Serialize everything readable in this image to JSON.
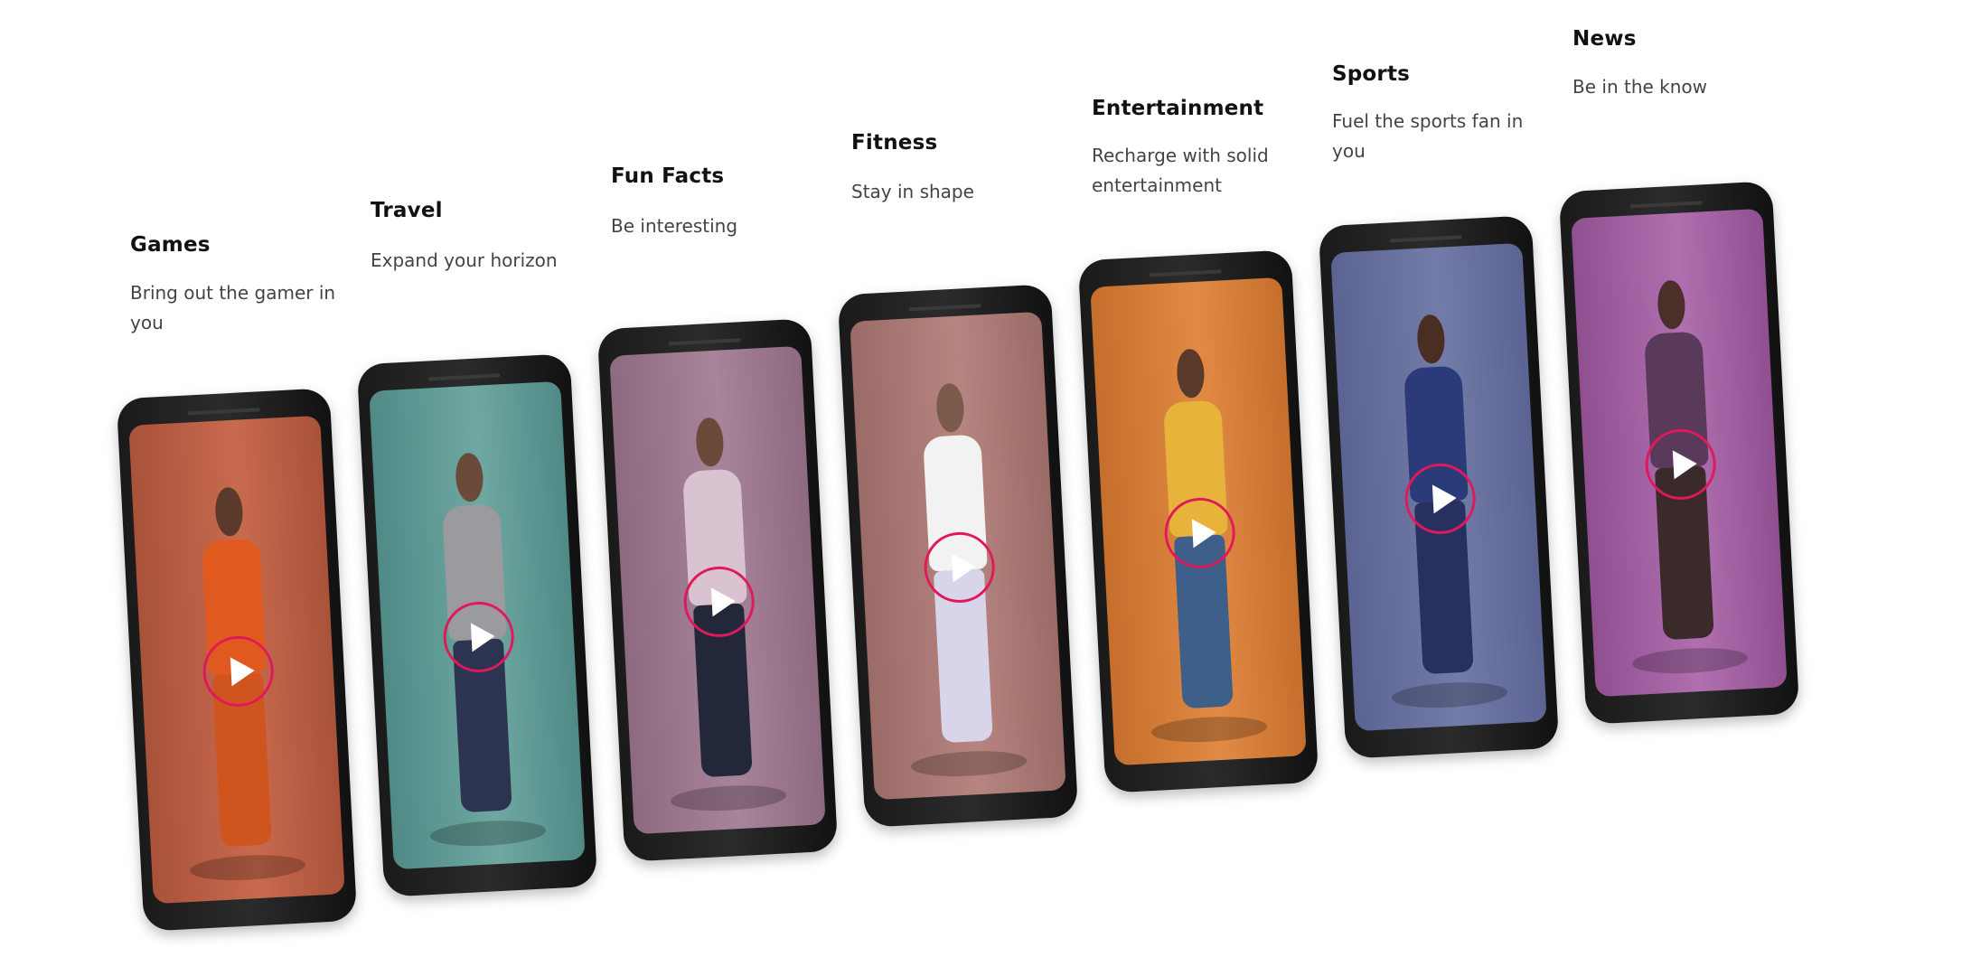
{
  "categories": [
    {
      "title": "Games",
      "subtitle": "Bring out the gamer in you",
      "screen_color": "#c86a4e",
      "screen_color_2": "#a9523a",
      "figure_colors": [
        "#5a3a2a",
        "#e05a20",
        "#d0541e"
      ]
    },
    {
      "title": "Travel",
      "subtitle": "Expand your horizon",
      "screen_color": "#6fa8a2",
      "screen_color_2": "#4f8a86",
      "figure_colors": [
        "#6b4a3a",
        "#9a9a9f",
        "#2c3452"
      ]
    },
    {
      "title": "Fun Facts",
      "subtitle": "Be interesting",
      "screen_color": "#a88499",
      "screen_color_2": "#8d6a80",
      "figure_colors": [
        "#6a4a3a",
        "#d9c3d0",
        "#23273a"
      ]
    },
    {
      "title": "Fitness",
      "subtitle": "Stay in shape",
      "screen_color": "#b78580",
      "screen_color_2": "#9a6b67",
      "figure_colors": [
        "#7a5a4a",
        "#f2f2f2",
        "#d8d4ea"
      ]
    },
    {
      "title": "Entertainment",
      "subtitle": "Recharge with solid entertainment",
      "screen_color": "#e08a45",
      "screen_color_2": "#c66f2c",
      "figure_colors": [
        "#5a3a2a",
        "#e8b33a",
        "#3e5f8a"
      ]
    },
    {
      "title": "Sports",
      "subtitle": "Fuel the sports fan in you",
      "screen_color": "#737ca8",
      "screen_color_2": "#5b6392",
      "figure_colors": [
        "#4a2e22",
        "#2b3a78",
        "#27305e"
      ]
    },
    {
      "title": "News",
      "subtitle": "Be in the know",
      "screen_color": "#b070b0",
      "screen_color_2": "#8f4f90",
      "figure_colors": [
        "#4a3028",
        "#5a3a5a",
        "#3a2a2a"
      ]
    }
  ],
  "accent_color": "#e0195a",
  "play_icon": "play-icon"
}
